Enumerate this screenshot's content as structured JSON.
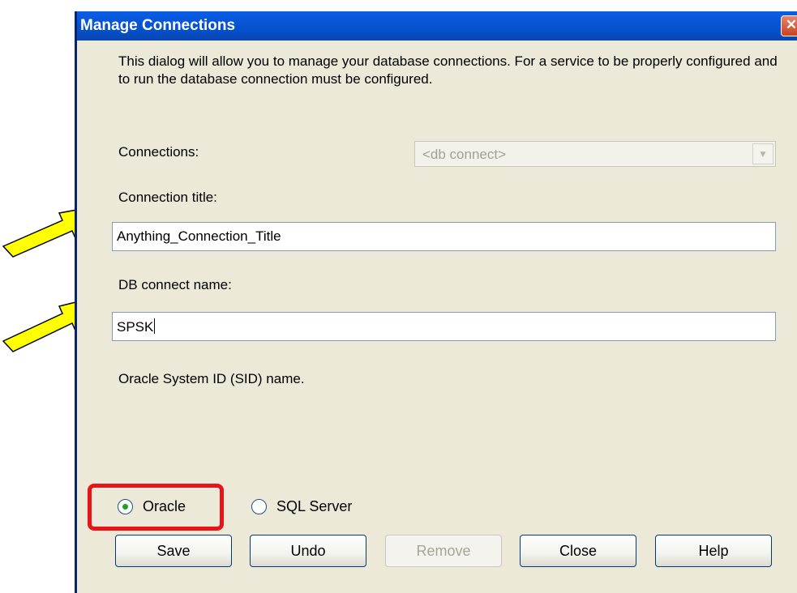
{
  "dialog": {
    "title": "Manage Connections",
    "close_label": "✕",
    "intro_text": "This dialog will allow you to manage your database connections. For a service to be properly configured and to run the database connection must be configured."
  },
  "form": {
    "connections_label": "Connections:",
    "connections_value": "<db connect>",
    "connection_title_label": "Connection title:",
    "connection_title_value": "Anything_Connection_Title",
    "db_connect_label": "DB connect name:",
    "db_connect_value": "SPSK",
    "hint_text": "Oracle System ID (SID) name."
  },
  "db_type": {
    "options": [
      {
        "label": "Oracle",
        "selected": true
      },
      {
        "label": "SQL Server",
        "selected": false
      }
    ]
  },
  "buttons": {
    "save": "Save",
    "undo": "Undo",
    "remove": "Remove",
    "close": "Close",
    "help": "Help"
  },
  "colors": {
    "dialog_bg": "#ece9d8",
    "titlebar": "#0550c8",
    "annotation_arrow": "#ffff00",
    "annotation_box": "#e8141a"
  }
}
